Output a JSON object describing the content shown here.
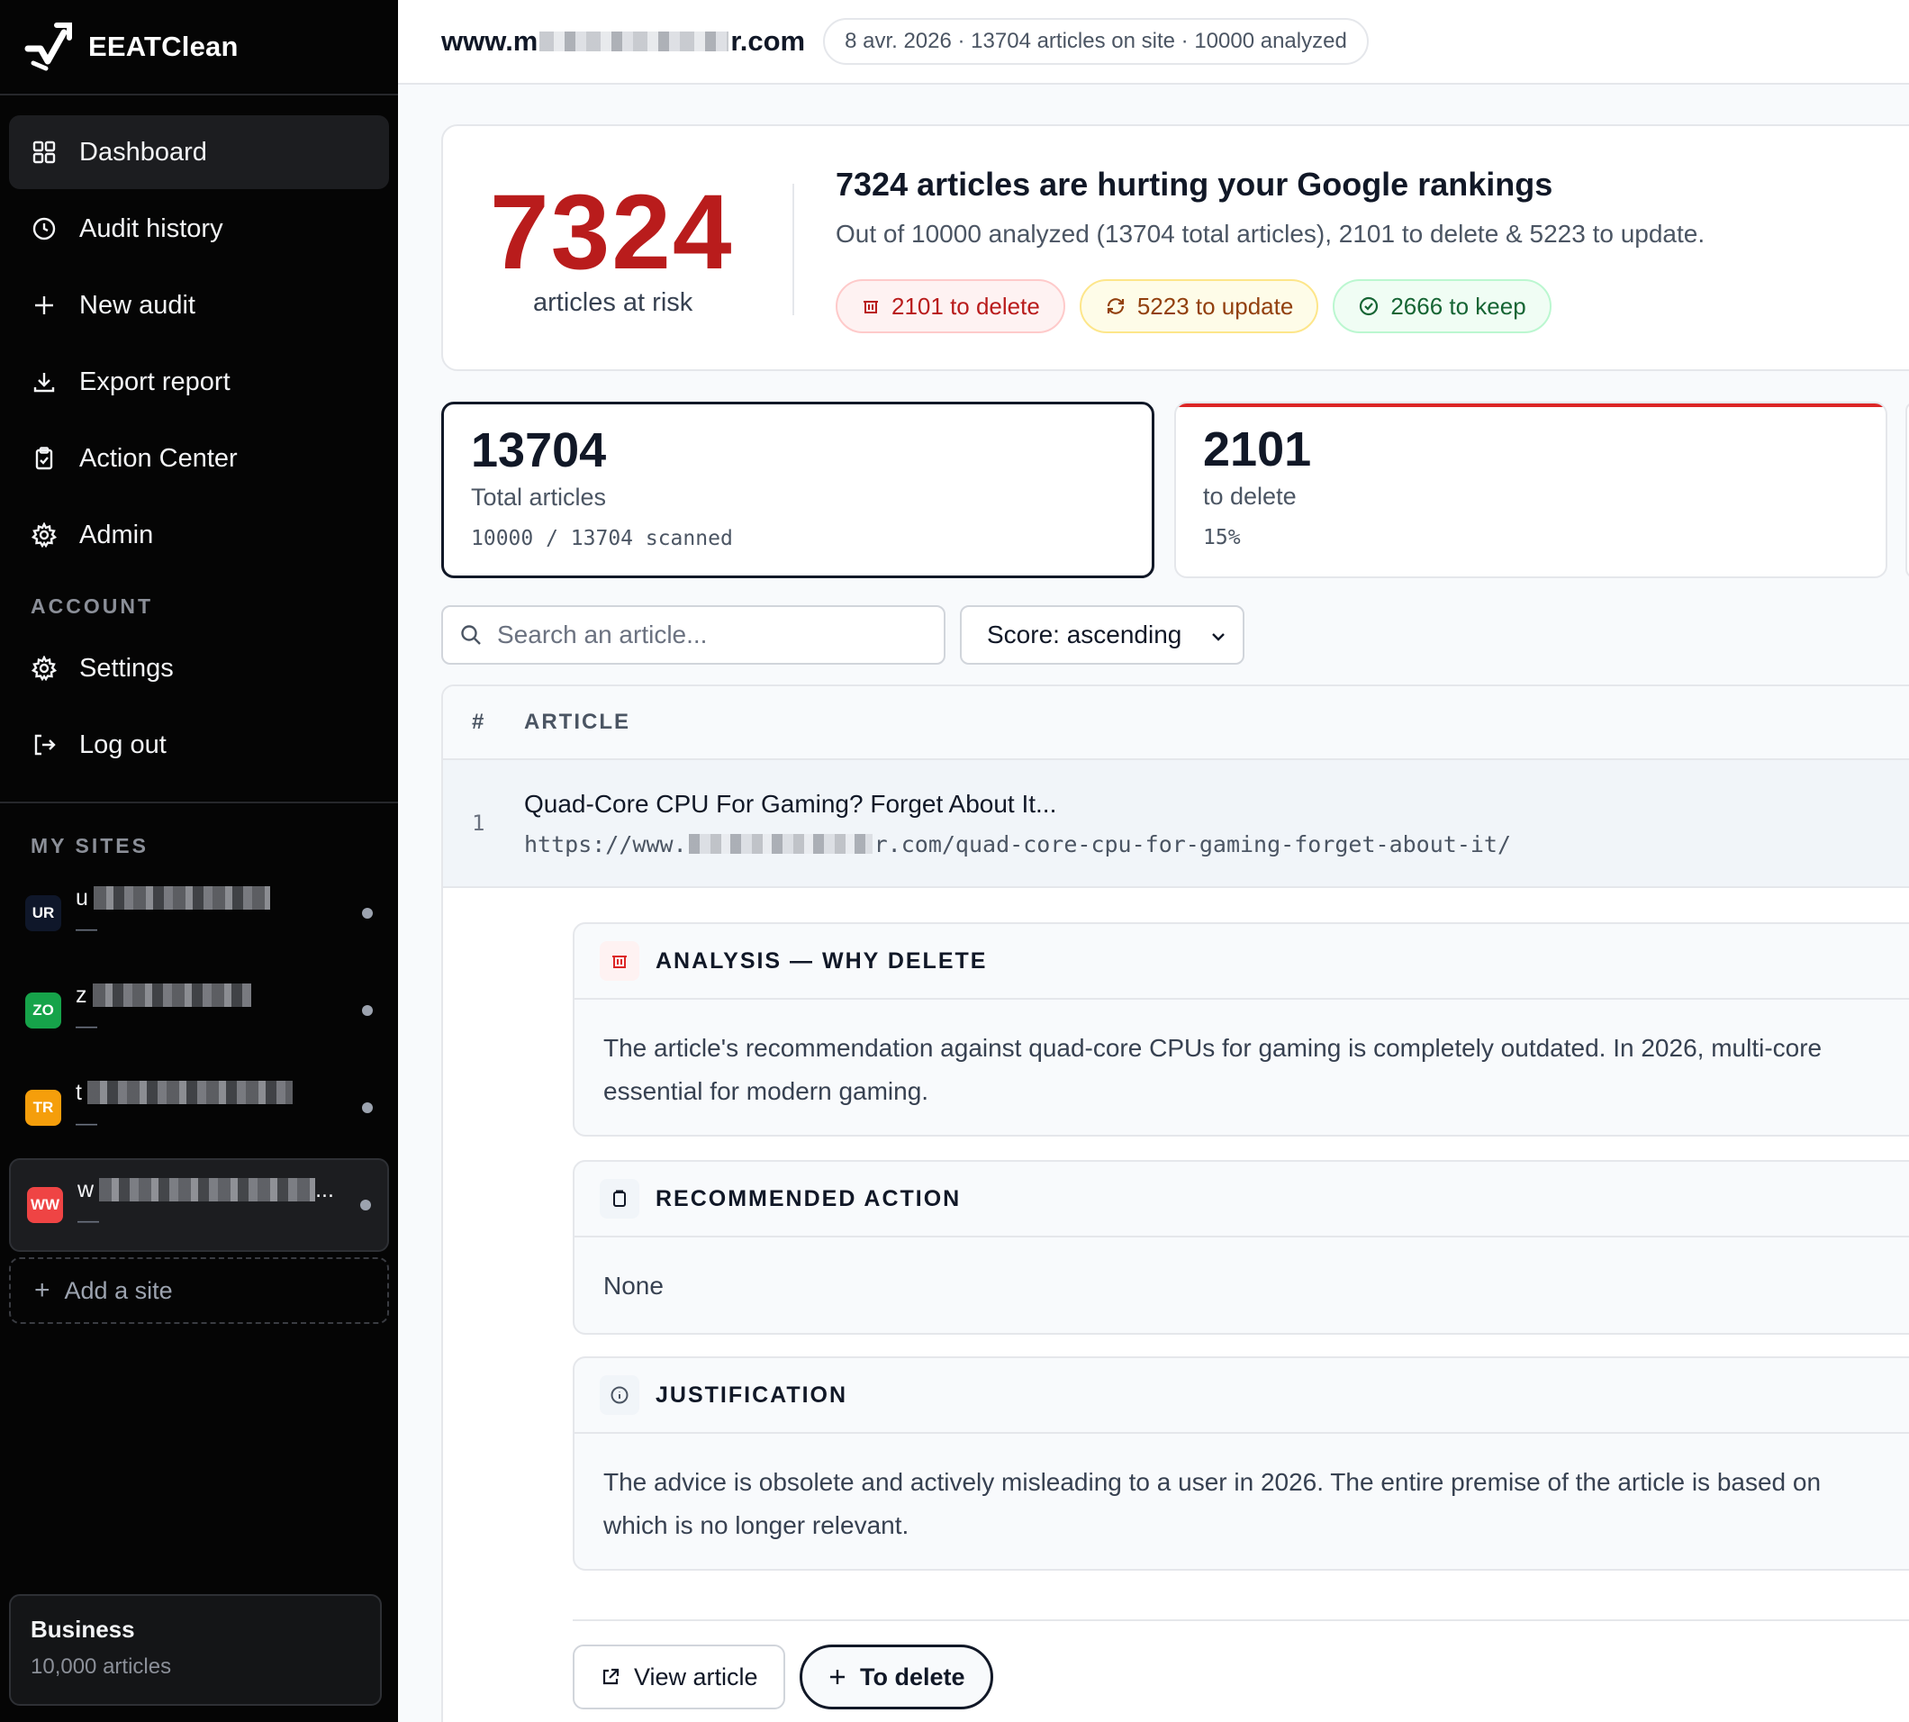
{
  "app": {
    "name": "EEATClean"
  },
  "nav": {
    "items": [
      {
        "label": "Dashboard",
        "icon": "grid-icon"
      },
      {
        "label": "Audit history",
        "icon": "clock-icon"
      },
      {
        "label": "New audit",
        "icon": "plus-icon"
      },
      {
        "label": "Export report",
        "icon": "download-icon"
      },
      {
        "label": "Action Center",
        "icon": "clipboard-check-icon"
      },
      {
        "label": "Admin",
        "icon": "gear-icon"
      }
    ],
    "account_label": "ACCOUNT",
    "account_items": [
      {
        "label": "Settings",
        "icon": "gear-icon"
      },
      {
        "label": "Log out",
        "icon": "logout-icon"
      }
    ]
  },
  "sites": {
    "label": "MY SITES",
    "items": [
      {
        "badge": "UR",
        "initial": "u",
        "sub": "—",
        "color": "#0f172a"
      },
      {
        "badge": "ZO",
        "initial": "z",
        "sub": "—",
        "color": "#16a34a"
      },
      {
        "badge": "TR",
        "initial": "t",
        "sub": "—",
        "color": "#f59e0b"
      },
      {
        "badge": "WW",
        "initial": "w",
        "ellipsis": "...",
        "sub": "—",
        "color": "#ef4444"
      }
    ],
    "add_label": "Add a site"
  },
  "plan": {
    "name": "Business",
    "quota": "10,000 articles"
  },
  "topbar": {
    "domain_prefix": "www.m",
    "domain_suffix": "r.com",
    "meta": "8 avr. 2026 · 13704 articles on site · 10000 analyzed"
  },
  "hero": {
    "count": "7324",
    "count_label": "articles at risk",
    "title": "7324 articles are hurting your Google rankings",
    "subtitle": "Out of 10000 analyzed (13704 total articles), 2101 to delete & 5223 to update.",
    "chips": {
      "delete": "2101 to delete",
      "update": "5223 to update",
      "keep": "2666 to keep"
    }
  },
  "stats": [
    {
      "value": "13704",
      "label": "Total articles",
      "sub": "10000 / 13704 scanned"
    },
    {
      "value": "2101",
      "label": "to delete",
      "sub": "15%"
    }
  ],
  "filters": {
    "search_placeholder": "Search an article...",
    "sort_value": "Score: ascending"
  },
  "table": {
    "col_index": "#",
    "col_article": "ARTICLE",
    "rows": [
      {
        "index": "1",
        "title": "Quad-Core CPU For Gaming? Forget About It...",
        "url_prefix": "https://www.",
        "url_suffix": "r.com/quad-core-cpu-for-gaming-forget-about-it/"
      }
    ]
  },
  "detail": {
    "analysis_title": "ANALYSIS — WHY DELETE",
    "analysis_line1": "The article's recommendation against quad-core CPUs for gaming is completely outdated. In 2026, multi-core",
    "analysis_line2": "essential for modern gaming.",
    "action_title": "RECOMMENDED ACTION",
    "action_body": "None",
    "justification_title": "JUSTIFICATION",
    "justification_line1": "The advice is obsolete and actively misleading to a user in 2026. The entire premise of the article is based on",
    "justification_line2": "which is no longer relevant.",
    "view_label": "View article",
    "delete_label": "To delete"
  },
  "colors": {
    "danger": "#b91c1c",
    "warning": "#92400e",
    "success": "#166534",
    "sidebar": "#050505"
  }
}
